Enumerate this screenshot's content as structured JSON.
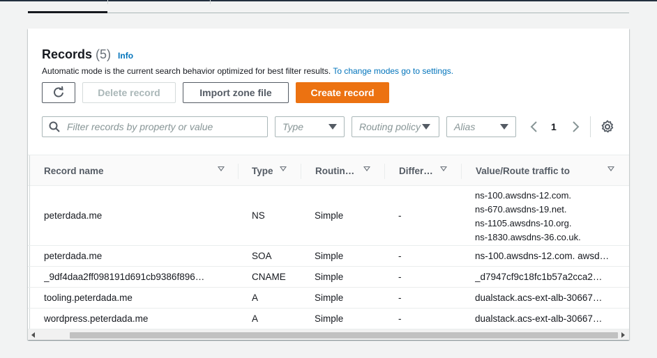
{
  "records": {
    "title": "Records",
    "count": "(5)",
    "info_link": "Info",
    "description": "Automatic mode is the current search behavior optimized for best filter results.",
    "description_link": "To change modes go to settings."
  },
  "toolbar": {
    "delete_label": "Delete record",
    "import_label": "Import zone file",
    "create_label": "Create record"
  },
  "filters": {
    "search_placeholder": "Filter records by property or value",
    "type_placeholder": "Type",
    "routing_placeholder": "Routing policy",
    "alias_placeholder": "Alias"
  },
  "pagination": {
    "current_page": "1"
  },
  "table": {
    "columns": [
      "Record name",
      "Type",
      "Routin…",
      "Differ…",
      "Value/Route traffic to"
    ],
    "rows": [
      {
        "name": "peterdada.me",
        "type": "NS",
        "routing": "Simple",
        "differ": "-",
        "values": [
          "ns-100.awsdns-12.com.",
          "ns-670.awsdns-19.net.",
          "ns-1105.awsdns-10.org.",
          "ns-1830.awsdns-36.co.uk."
        ]
      },
      {
        "name": "peterdada.me",
        "type": "SOA",
        "routing": "Simple",
        "differ": "-",
        "value": "ns-100.awsdns-12.com. awsd…"
      },
      {
        "name": "_9df4daa2ff098191d691cb9386f896…",
        "type": "CNAME",
        "routing": "Simple",
        "differ": "-",
        "value": "_d7947cf9c18fc1b57a2cca2…"
      },
      {
        "name": "tooling.peterdada.me",
        "type": "A",
        "routing": "Simple",
        "differ": "-",
        "value": "dualstack.acs-ext-alb-30667…"
      },
      {
        "name": "wordpress.peterdada.me",
        "type": "A",
        "routing": "Simple",
        "differ": "-",
        "value": "dualstack.acs-ext-alb-30667…"
      }
    ]
  },
  "colors": {
    "primary_button": "#ec7211",
    "link": "#0073bb",
    "text": "#16191f",
    "muted": "#687078"
  }
}
